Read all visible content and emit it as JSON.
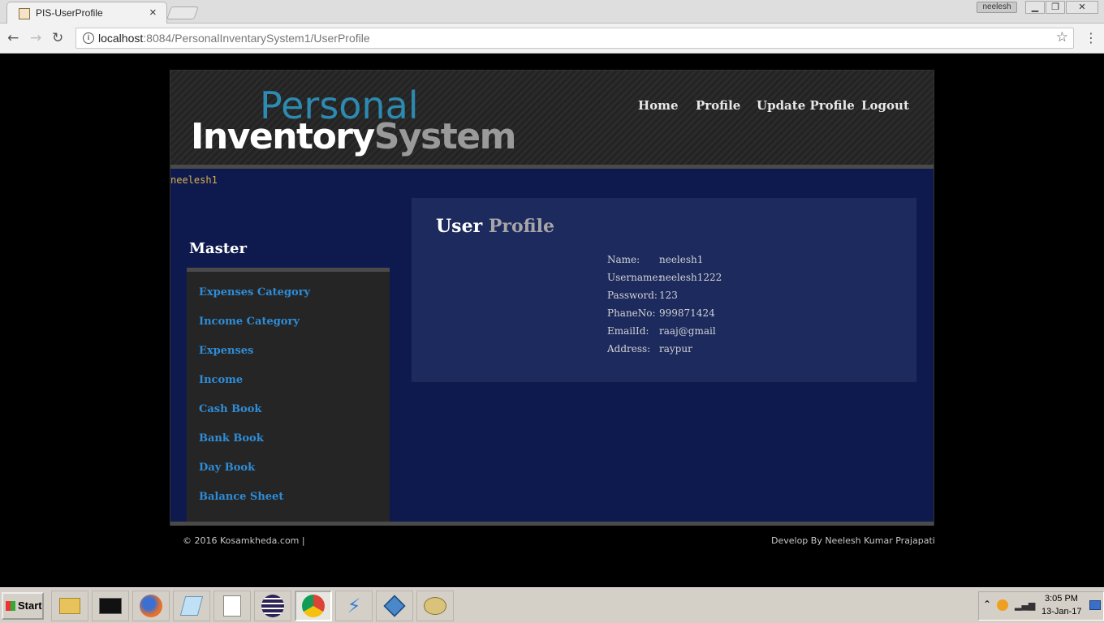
{
  "browser": {
    "tab_title": "PIS-UserProfile",
    "tab_close": "×",
    "profile_badge": "neelesh",
    "url_host": "localhost",
    "url_rest": ":8084/PersonalInventarySystem1/UserProfile",
    "back_glyph": "←",
    "forward_glyph": "→",
    "reload_glyph": "↻",
    "star_glyph": "☆",
    "menu_glyph": "⋮",
    "min_glyph": "▁",
    "max_glyph": "❐",
    "close_glyph": "✕"
  },
  "site": {
    "logo_top": "Personal",
    "logo_bottom_a": "Inventory",
    "logo_bottom_b": "System",
    "nav": [
      "Home",
      "Profile",
      "Update Profile",
      "Logout"
    ],
    "logged_user": "neelesh1",
    "sidebar_heading": "Master",
    "sidebar_items": [
      "Expenses Category",
      "Income Category",
      "Expenses",
      "Income",
      "Cash Book",
      "Bank Book",
      "Day Book",
      "Balance Sheet"
    ],
    "panel_title_a": "User",
    "panel_title_b": "Profile",
    "profile": [
      {
        "label": "Name:",
        "value": "neelesh1"
      },
      {
        "label": "Username:",
        "value": "neelesh1222"
      },
      {
        "label": "Password:",
        "value": "123"
      },
      {
        "label": "PhaneNo:",
        "value": "999871424"
      },
      {
        "label": "EmailId:",
        "value": "raaj@gmail"
      },
      {
        "label": "Address:",
        "value": "raypur"
      }
    ],
    "footer_left": "© 2016 Kosamkheda.com |",
    "footer_right": "Develop By Neelesh Kumar Prajapati"
  },
  "taskbar": {
    "start_label": "Start",
    "apps": [
      "file-explorer-icon",
      "command-prompt-icon",
      "firefox-icon",
      "notepad-icon",
      "wordpad-icon",
      "eclipse-icon",
      "chrome-icon",
      "flash-icon",
      "virtualbox-icon",
      "paint-icon"
    ],
    "time": "3:05 PM",
    "date": "13-Jan-17"
  },
  "colors": {
    "page_bg": "#0e1a4e",
    "panel_bg": "#1d2a5e",
    "link_blue": "#2f8cd6",
    "logo_blue": "#2d8ab0",
    "username_gold": "#d9b04a"
  }
}
